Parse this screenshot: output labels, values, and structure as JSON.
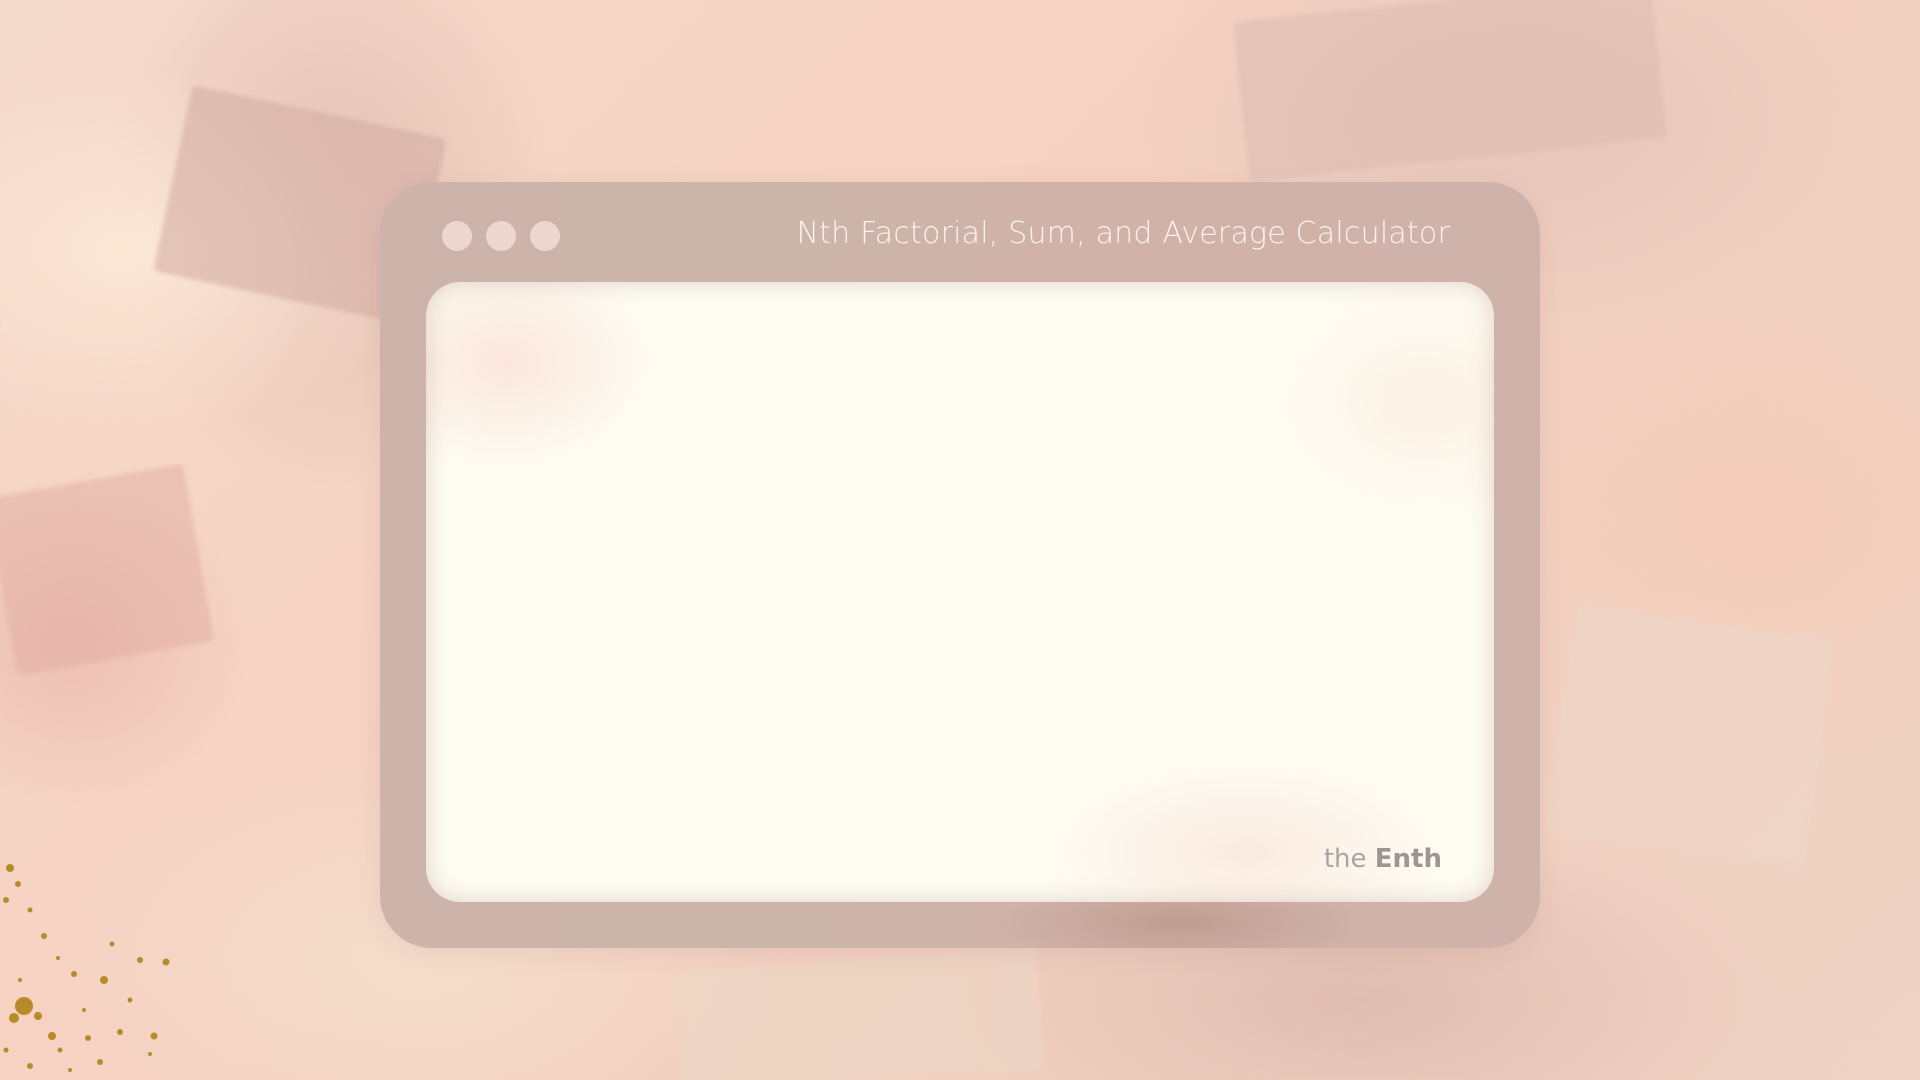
{
  "window": {
    "title": "Nth Factorial, Sum, and Average Calculator",
    "controls": [
      "close",
      "minimize",
      "maximize"
    ]
  },
  "brand": {
    "prefix": "the",
    "name": "Enth"
  },
  "colors": {
    "frame": "#cdb3aa",
    "panel": "#fefdf3",
    "title_text": "#fbf3ef",
    "control_dot": "#ecd6cf",
    "brand_text": "#9c9593"
  }
}
